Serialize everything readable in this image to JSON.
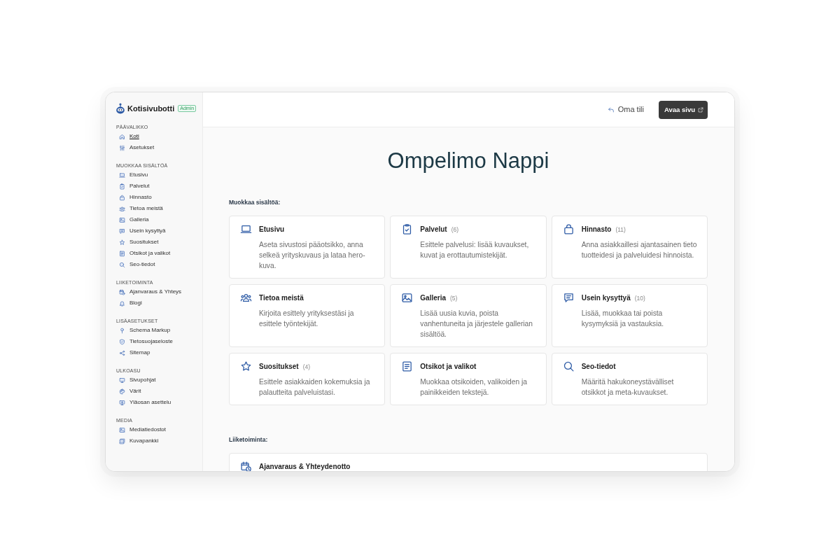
{
  "brand": {
    "name": "Kotisivubotti",
    "badge": "Admin"
  },
  "sidebar": {
    "sections": [
      {
        "heading": "PÄÄVALIKKO",
        "items": [
          {
            "label": "Koti",
            "selected": true
          },
          {
            "label": "Asetukset",
            "selected": false
          }
        ]
      },
      {
        "heading": "MUOKKAA SISÄLTÖÄ",
        "items": [
          {
            "label": "Etusivu",
            "selected": false
          },
          {
            "label": "Palvelut",
            "selected": false
          },
          {
            "label": "Hinnasto",
            "selected": false
          },
          {
            "label": "Tietoa meistä",
            "selected": false
          },
          {
            "label": "Galleria",
            "selected": false
          },
          {
            "label": "Usein kysyttyä",
            "selected": false
          },
          {
            "label": "Suositukset",
            "selected": false
          },
          {
            "label": "Otsikot ja valikot",
            "selected": false
          },
          {
            "label": "Seo-tiedot",
            "selected": false
          }
        ]
      },
      {
        "heading": "LIIKETOIMINTA",
        "items": [
          {
            "label": "Ajanvaraus & Yhteys",
            "selected": false
          },
          {
            "label": "Blogi",
            "selected": false
          }
        ]
      },
      {
        "heading": "LISÄASETUKSET",
        "items": [
          {
            "label": "Schema Markup",
            "selected": false
          },
          {
            "label": "Tietosuojaseloste",
            "selected": false
          },
          {
            "label": "Sitemap",
            "selected": false
          }
        ]
      },
      {
        "heading": "ULKOASU",
        "items": [
          {
            "label": "Sivupohjat",
            "selected": false
          },
          {
            "label": "Värit",
            "selected": false
          },
          {
            "label": "Yläosan asettelu",
            "selected": false
          }
        ]
      },
      {
        "heading": "MEDIA",
        "items": [
          {
            "label": "Mediatiedostot",
            "selected": false
          },
          {
            "label": "Kuvapankki",
            "selected": false
          }
        ]
      }
    ]
  },
  "header": {
    "account_link": "Oma tili",
    "open_site_button": "Avaa sivu"
  },
  "page_title": "Ompelimo Nappi",
  "content_sections": [
    {
      "heading": "Muokkaa sisältöä:",
      "kind": "grid",
      "cards": [
        {
          "title": "Etusivu",
          "description": "Aseta sivustosi pääotsikko, anna selkeä yrityskuvaus ja lataa hero-kuva."
        },
        {
          "title": "Palvelut",
          "count": "(6)",
          "description": "Esittele palvelusi: lisää kuvaukset, kuvat ja erottautumistekijät."
        },
        {
          "title": "Hinnasto",
          "count": "(11)",
          "description": "Anna asiakkaillesi ajantasainen tieto tuotteidesi ja palveluidesi hinnoista."
        },
        {
          "title": "Tietoa meistä",
          "description": "Kirjoita esittely yrityksestäsi ja esittele työntekijät."
        },
        {
          "title": "Galleria",
          "count": "(5)",
          "description": "Lisää uusia kuvia, poista vanhentuneita ja järjestele gallerian sisältöä."
        },
        {
          "title": "Usein kysyttyä",
          "count": "(10)",
          "description": "Lisää, muokkaa tai poista kysymyksiä ja vastauksia."
        },
        {
          "title": "Suositukset",
          "count": "(4)",
          "description": "Esittele asiakkaiden kokemuksia ja palautteita palveluistasi."
        },
        {
          "title": "Otsikot ja valikot",
          "description": "Muokkaa otsikoiden, valikoiden ja painikkeiden tekstejä."
        },
        {
          "title": "Seo-tiedot",
          "description": "Määritä hakukoneystävälliset otsikkot ja meta-kuvaukset."
        }
      ]
    },
    {
      "heading": "Liiketoiminta:",
      "kind": "list",
      "cards": [
        {
          "title": "Ajanvaraus & Yhteydenotto"
        }
      ]
    }
  ]
}
